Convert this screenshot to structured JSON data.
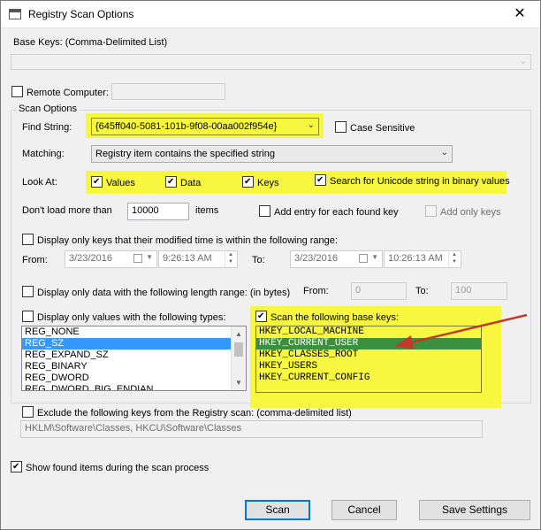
{
  "window": {
    "title": "Registry Scan Options",
    "close_glyph": "✕"
  },
  "base_keys": {
    "label": "Base Keys:  (Comma-Delimited List)",
    "value": ""
  },
  "remote": {
    "label": "Remote Computer:",
    "checked": false,
    "value": ""
  },
  "scan_options": {
    "group_label": "Scan Options",
    "find_string_label": "Find String:",
    "find_string_value": "{645ff040-5081-101b-9f08-00aa002f954e}",
    "case_sensitive_label": "Case Sensitive",
    "matching_label": "Matching:",
    "matching_value": "Registry item contains the specified string",
    "look_at_label": "Look At:",
    "values_label": "Values",
    "data_label": "Data",
    "keys_label": "Keys",
    "unicode_label": "Search for Unicode string in binary values",
    "dont_load_label": "Don't load more than",
    "dont_load_value": "10000",
    "items_label": "items",
    "add_entry_label": "Add entry for each found key",
    "add_only_keys_label": "Add only keys"
  },
  "time_range": {
    "label": "Display only keys that their modified time is within the following range:",
    "from_label": "From:",
    "from_date": "3/23/2016",
    "from_time": "9:26:13 AM",
    "to_label": "To:",
    "to_date": "3/23/2016",
    "to_time": "10:26:13 AM"
  },
  "length_range": {
    "label": "Display only data with the following length range: (in bytes)",
    "from_label": "From:",
    "from_value": "0",
    "to_label": "To:",
    "to_value": "100"
  },
  "value_types": {
    "label": "Display only values with the following types:",
    "items": [
      "REG_NONE",
      "REG_SZ",
      "REG_EXPAND_SZ",
      "REG_BINARY",
      "REG_DWORD",
      "REG_DWORD_BIG_ENDIAN"
    ],
    "selected_index": 1
  },
  "base_keys_scan": {
    "label": "Scan the following base keys:",
    "items": [
      "HKEY_LOCAL_MACHINE",
      "HKEY_CURRENT_USER",
      "HKEY_CLASSES_ROOT",
      "HKEY_USERS",
      "HKEY_CURRENT_CONFIG"
    ],
    "selected_index": 1
  },
  "exclude": {
    "label": "Exclude the following keys from the Registry scan: (comma-delimited list)",
    "value": "HKLM\\Software\\Classes, HKCU\\Software\\Classes"
  },
  "show_found": {
    "label": "Show found items during the scan process"
  },
  "buttons": {
    "scan": "Scan",
    "cancel": "Cancel",
    "save_settings": "Save Settings"
  },
  "colors": {
    "highlight": "#f7f73f",
    "selection": "#3399ff",
    "annotation_arrow": "#c0392b",
    "selected_key": "#3c8f3c"
  }
}
